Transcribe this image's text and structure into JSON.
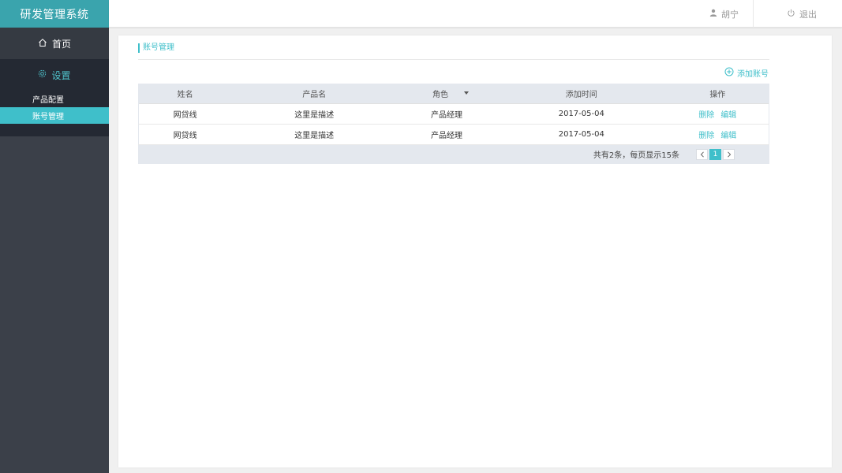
{
  "brand": {
    "title": "研发管理系统",
    "accent": "#3aa4ad"
  },
  "nav": {
    "home": {
      "icon": "home-icon",
      "label": "首页"
    },
    "settings": {
      "icon": "gear-icon",
      "label": "设置"
    },
    "sub_items": [
      {
        "label": "产品配置",
        "active": false
      },
      {
        "label": "账号管理",
        "active": true
      }
    ]
  },
  "header": {
    "user": {
      "icon": "user-icon",
      "name": "胡宁"
    },
    "logout": {
      "icon": "power-icon",
      "label": "退出"
    }
  },
  "page": {
    "title": "账号管理",
    "add_button": {
      "icon": "plus-circle-icon",
      "label": "添加账号"
    }
  },
  "table": {
    "columns": [
      "姓名",
      "产品名",
      "角色",
      "添加时间",
      "操作"
    ],
    "rows": [
      {
        "name": "网贷线",
        "product": "这里是描述",
        "role": "产品经理",
        "date": "2017-05-04",
        "actions": [
          "删除",
          "编辑"
        ]
      },
      {
        "name": "网贷线",
        "product": "这里是描述",
        "role": "产品经理",
        "date": "2017-05-04",
        "actions": [
          "删除",
          "编辑"
        ]
      }
    ],
    "pagination": {
      "info": "共有2条，每页显示15条",
      "current_page": "1",
      "prev_icon": "chevron-left-icon",
      "next_icon": "chevron-right-icon"
    }
  }
}
